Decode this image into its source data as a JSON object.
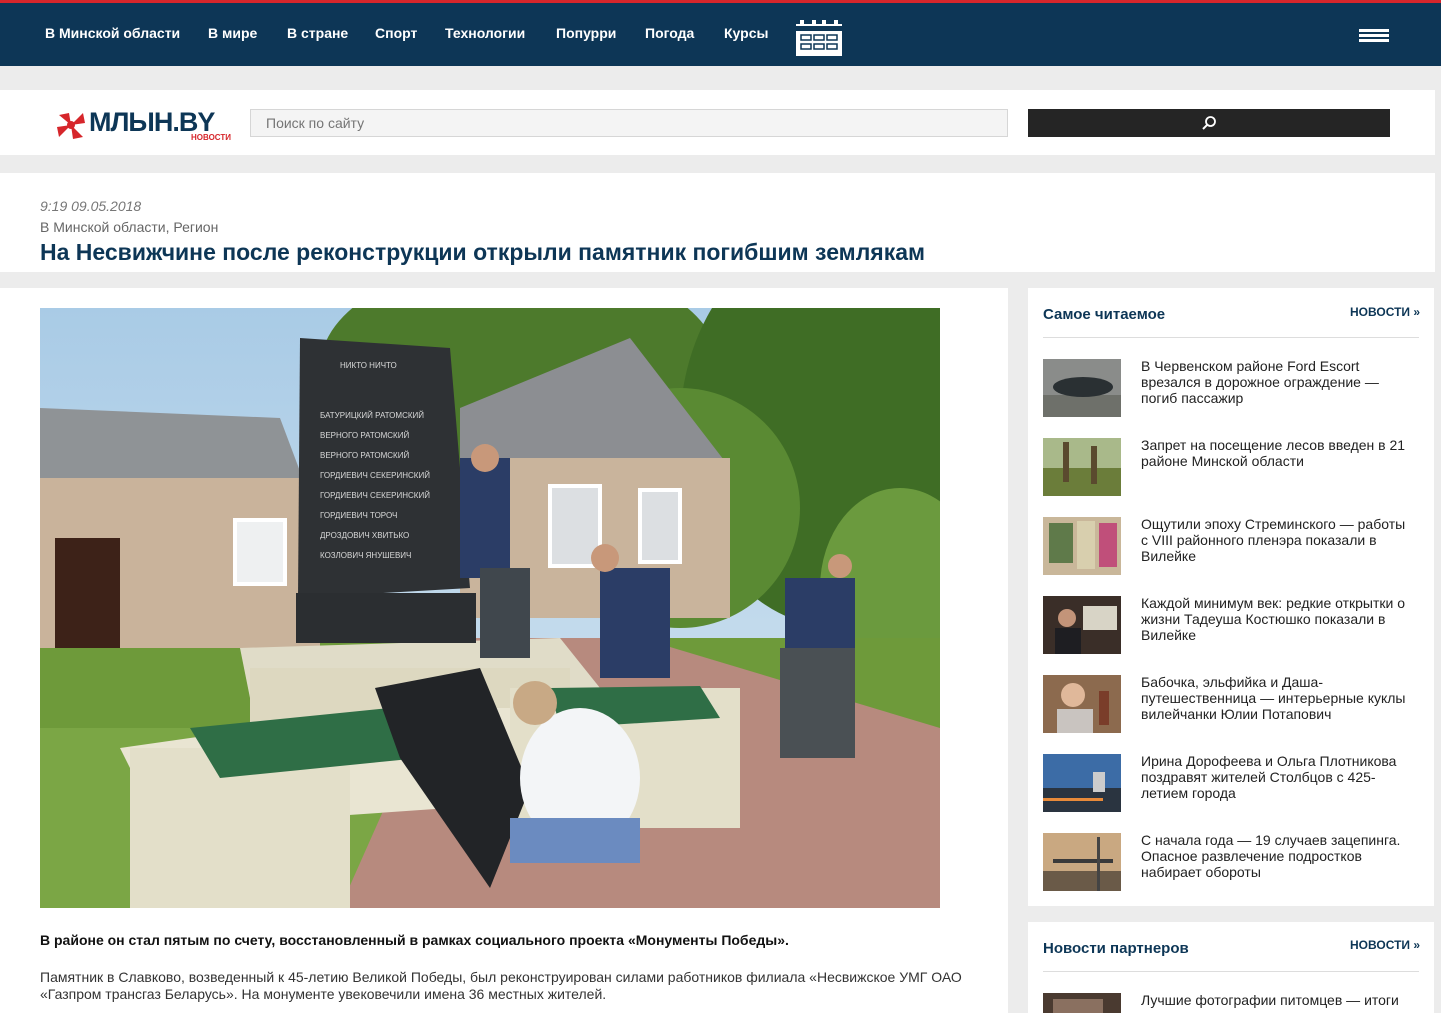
{
  "nav": {
    "items": [
      "В Минской области",
      "В мире",
      "В стране",
      "Спорт",
      "Технологии",
      "Попурри",
      "Погода",
      "Курсы"
    ]
  },
  "logo": {
    "brand": "МЛЫН.BY",
    "sub": "НОВОСТИ"
  },
  "search": {
    "placeholder": "Поиск по сайту"
  },
  "article": {
    "datetime": "9:19 09.05.2018",
    "categories": "В Минской области, Регион",
    "title": "На Несвижчине после реконструкции открыли памятник погибшим землякам",
    "lead": "В районе он стал пятым по счету, восстановленный в рамках социального проекта «Монументы Победы».",
    "body": "Памятник в Славково, возведенный к 45-летию Великой Победы, был реконструирован силами работников филиала «Несвижское УМГ ОАО «Газпром трансгаз Беларусь». На монументе увековечили имена 36 местных жителей."
  },
  "most_read": {
    "title": "Самое читаемое",
    "link": "НОВОСТИ",
    "items": [
      "В Червенском районе Ford Escort врезался в дорожное ограждение — погиб пассажир",
      "Запрет на посещение лесов введен в 21 районе Минской области",
      "Ощутили эпоху Стреминского — работы с VIII районного пленэра показали в Вилейке",
      "Каждой минимум век: редкие открытки о жизни Тадеуша Костюшко показали в Вилейке",
      "Бабочка, эльфийка и Даша-путешественница — интерьерные куклы вилейчанки Юлии Потапович",
      "Ирина Дорофеева и Ольга Плотникова поздравят жителей Столбцов с 425-летием города",
      "С начала года — 19 случаев зацепинга. Опасное развлечение подростков набирает обороты"
    ]
  },
  "partners": {
    "title": "Новости партнеров",
    "link": "НОВОСТИ",
    "items": [
      "Лучшие фотографии питомцев — итоги"
    ]
  }
}
